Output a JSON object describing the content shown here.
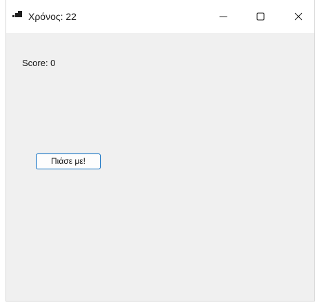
{
  "window": {
    "title": "Χρόνος: 22"
  },
  "titlebar": {
    "buttons": {
      "minimize_icon": "minimize-icon",
      "maximize_icon": "maximize-icon",
      "close_icon": "close-icon"
    }
  },
  "main": {
    "score_label": "Score: 0",
    "catch_button_label": "Πιάσε με!"
  },
  "colors": {
    "window_bg": "#f0f0f0",
    "titlebar_bg": "#ffffff",
    "button_border": "#0067c0"
  }
}
